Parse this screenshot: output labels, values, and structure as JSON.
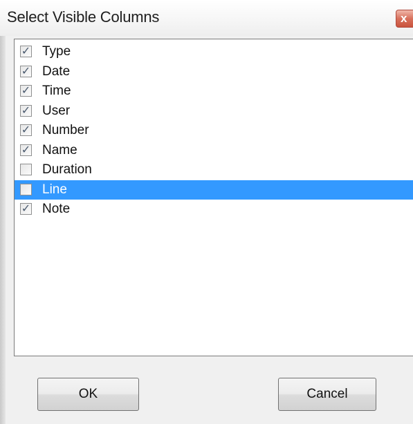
{
  "window": {
    "title": "Select Visible Columns",
    "close_symbol": "x"
  },
  "columns": [
    {
      "label": "Type",
      "checked": true,
      "selected": false
    },
    {
      "label": "Date",
      "checked": true,
      "selected": false
    },
    {
      "label": "Time",
      "checked": true,
      "selected": false
    },
    {
      "label": "User",
      "checked": true,
      "selected": false
    },
    {
      "label": "Number",
      "checked": true,
      "selected": false
    },
    {
      "label": "Name",
      "checked": true,
      "selected": false
    },
    {
      "label": "Duration",
      "checked": false,
      "selected": false
    },
    {
      "label": "Line",
      "checked": false,
      "selected": true
    },
    {
      "label": "Note",
      "checked": true,
      "selected": false
    }
  ],
  "buttons": {
    "ok_label": "OK",
    "cancel_label": "Cancel"
  },
  "colors": {
    "selection": "#3399ff",
    "close_button": "#c9533d"
  },
  "icons": {
    "checkmark": "check-icon",
    "close": "close-icon"
  }
}
